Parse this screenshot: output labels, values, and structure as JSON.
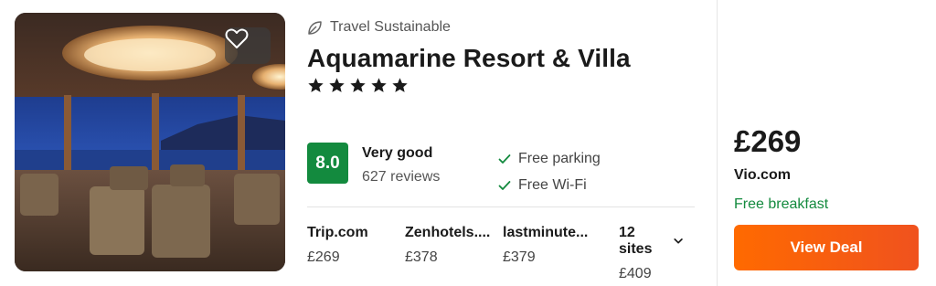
{
  "hotel": {
    "badge": "Travel Sustainable",
    "name": "Aquamarine Resort & Villa",
    "stars": 5,
    "rating": {
      "score": "8.0",
      "label": "Very good",
      "reviews": "627 reviews",
      "color": "#138a3e"
    },
    "amenities": [
      "Free parking",
      "Free Wi-Fi"
    ]
  },
  "sites": [
    {
      "name": "Trip.com",
      "price": "£269"
    },
    {
      "name": "Zenhotels....",
      "price": "£378"
    },
    {
      "name": "lastminute...",
      "price": "£379"
    }
  ],
  "more_sites": {
    "label": "12 sites",
    "price": "£409"
  },
  "deal": {
    "price": "£269",
    "site": "Vio.com",
    "perk": "Free breakfast",
    "button_label": "View Deal",
    "button_color": "#f4571a"
  },
  "icons": {
    "favorite": "heart-icon",
    "sustainable": "leaf-icon",
    "star": "star-icon",
    "amenity": "check-icon",
    "expand": "chevron-down-icon"
  }
}
